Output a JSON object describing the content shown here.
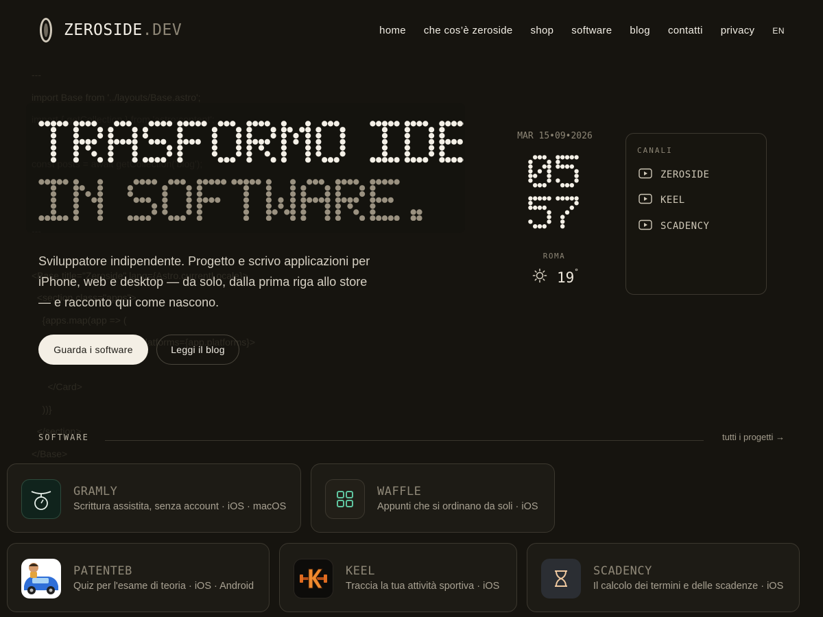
{
  "header": {
    "logo_main": "ZEROSIDE",
    "logo_suffix": ".DEV",
    "nav": [
      "home",
      "che cos’è zeroside",
      "shop",
      "software",
      "blog",
      "contatti",
      "privacy"
    ],
    "lang": "EN"
  },
  "background_code": [
    "---",
    "import Base from '../layouts/Base.astro';",
    "import { getCollection } from 'astro:content';",
    "",
    "const posts = await getCollection('blog');",
    "",
    "",
    "---",
    "",
    "<Base title=\"Zeroside\" lang={Astro.currentLocale}>",
    "  <section class=\"apps\">",
    "    {apps.map(app => (",
    "      <Card title={app.title} platforms={app.platforms}>",
    "",
    "      </Card>",
    "    ))}",
    "  </section>",
    "</Base>"
  ],
  "hero": {
    "title_line1": "TRASFORMO IDEE",
    "title_line2": "IN SOFTWARE.",
    "description": "Sviluppatore indipendente. Progetto e scrivo applicazioni per iPhone, web e desktop — da solo, dalla prima riga allo store — e racconto qui come nascono.",
    "primary_button": "Guarda i software",
    "secondary_button": "Leggi il blog"
  },
  "clock": {
    "date": "MAR 15•09•2026",
    "hours": "05",
    "minutes": "57",
    "city": "ROMA",
    "temperature": "19",
    "degree": "°",
    "weather_icon": "sun-icon"
  },
  "channels": {
    "title": "CANALI",
    "items": [
      "ZEROSIDE",
      "KEEL",
      "SCADENCY"
    ],
    "icon": "youtube-play-icon"
  },
  "software": {
    "label": "SOFTWARE",
    "all_link": "tutti i progetti →",
    "apps": [
      {
        "name": "GRAMLY",
        "desc": "Scrittura assistita, senza account · iOS · macOS",
        "icon": "scale-icon"
      },
      {
        "name": "WAFFLE",
        "desc": "Appunti che si ordinano da soli · iOS",
        "icon": "grid-icon"
      },
      {
        "name": "PATENTEB",
        "desc": "Quiz per l'esame di teoria · iOS · Android",
        "icon": "car-driver-icon"
      },
      {
        "name": "KEEL",
        "desc": "Traccia la tua attività sportiva · iOS",
        "icon": "dumbbell-k-icon"
      },
      {
        "name": "SCADENCY",
        "desc": "Il calcolo dei termini e delle scadenze · iOS",
        "icon": "hourglass-icon"
      }
    ]
  },
  "colors": {
    "background": "#16140f",
    "text": "#ece7dc",
    "dim_text": "#8d8676",
    "card_border": "#3c382f",
    "title_light": "#f4f0e7",
    "title_dim": "#9a9180"
  }
}
